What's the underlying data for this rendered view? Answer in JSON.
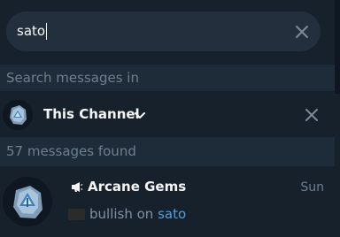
{
  "search": {
    "query": "sato"
  },
  "scope_section": {
    "label": "Search messages in"
  },
  "scope": {
    "channel_name": "This Channel"
  },
  "results_section": {
    "label": "57 messages found"
  },
  "result": {
    "title": "Arcane Gems",
    "time": "Sun",
    "snippet_prefix": "bullish on ",
    "snippet_match": "sato"
  },
  "colors": {
    "background": "#17212b",
    "search_box": "#242f3d",
    "section_band": "#1e2c3a",
    "highlight": "#4f9fe0"
  },
  "icons": {
    "clear_search": "close-icon",
    "dropdown": "chevron-down-icon",
    "remove_scope": "close-icon",
    "channel_type": "megaphone-icon"
  }
}
